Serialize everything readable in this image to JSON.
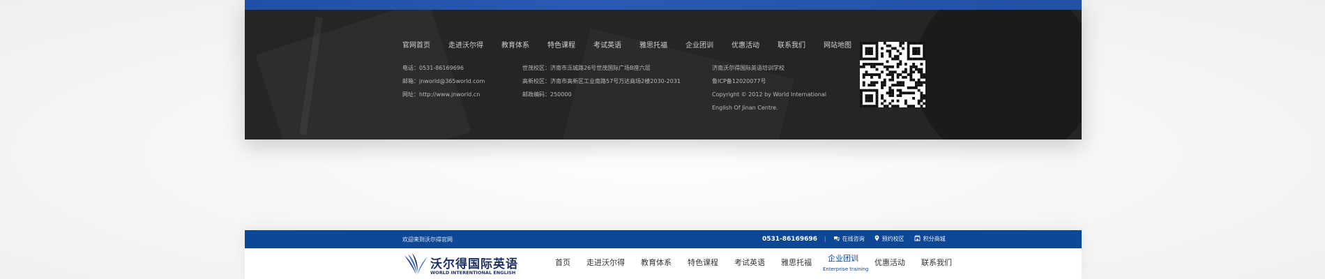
{
  "footer": {
    "nav": [
      "官网首页",
      "走进沃尔得",
      "教育体系",
      "特色课程",
      "考试英语",
      "雅思托福",
      "企业团训",
      "优惠活动",
      "联系我们",
      "网站地图"
    ],
    "contact": [
      "电话：0531-86169696",
      "邮箱：jnworld@365world.com",
      "网址：http://www.jnworld.cn"
    ],
    "campus": [
      "世茂校区：济南市泺城路26号世茂国际广场B座六层",
      "高新校区：济南市高新区工业南路57号万达商场2楼2030-2031",
      "邮政编码：250000"
    ],
    "company": [
      "济南沃尔得国际英语培训学校",
      "鲁ICP备12020077号",
      "Copyright © 2012 by World International",
      "English Of Jinan Centre."
    ]
  },
  "header": {
    "welcome": "欢迎来到沃尔得官网",
    "phone": "0531-86169696",
    "separator": "|",
    "links": [
      {
        "icon": "chat-icon",
        "label": "在线咨询"
      },
      {
        "icon": "location-icon",
        "label": "预约校区"
      },
      {
        "icon": "shop-icon",
        "label": "积分商城"
      }
    ],
    "logo_cn": "沃尔得国际英语",
    "logo_en": "WORLD INTERENTIONAL ENGLISH",
    "nav": [
      {
        "label": "首页"
      },
      {
        "label": "走进沃尔得"
      },
      {
        "label": "教育体系"
      },
      {
        "label": "特色课程"
      },
      {
        "label": "考试英语"
      },
      {
        "label": "雅思托福"
      },
      {
        "label": "企业团训",
        "sub": "Enterprise training",
        "active": true
      },
      {
        "label": "优惠活动"
      },
      {
        "label": "联系我们"
      }
    ]
  },
  "colors": {
    "brand_blue": "#0d4795",
    "footer_dark": "#252525"
  }
}
